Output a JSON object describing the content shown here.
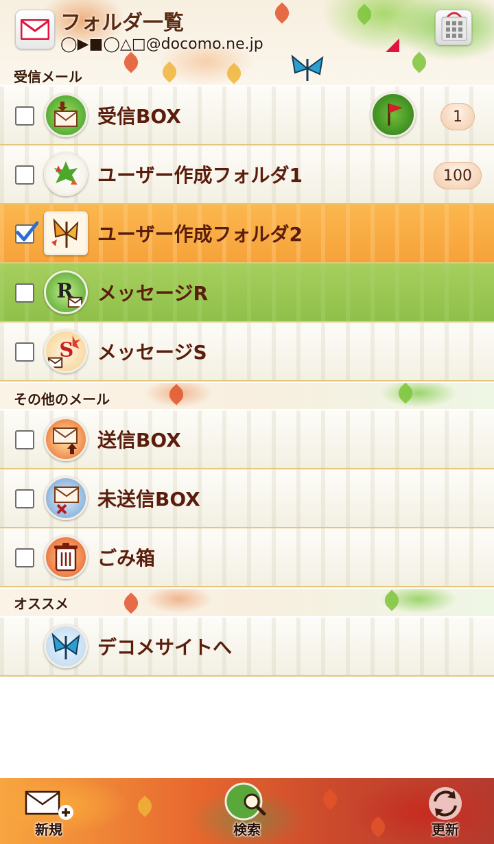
{
  "header": {
    "title": "フォルダ一覧",
    "address": "◯▶■◯△□@docomo.ne.jp"
  },
  "sections": {
    "inbox": "受信メール",
    "other": "その他のメール",
    "recommend": "オススメ"
  },
  "inbox_folders": [
    {
      "name": "受信BOX",
      "count": "1",
      "checked": false
    },
    {
      "name": "ユーザー作成フォルダ1",
      "count": "100",
      "checked": false
    },
    {
      "name": "ユーザー作成フォルダ2",
      "count": "",
      "checked": true
    },
    {
      "name": "メッセージR",
      "count": "",
      "checked": false
    },
    {
      "name": "メッセージS",
      "count": "",
      "checked": false
    }
  ],
  "other_folders": [
    {
      "name": "送信BOX"
    },
    {
      "name": "未送信BOX"
    },
    {
      "name": "ごみ箱"
    }
  ],
  "recommend_items": [
    {
      "name": "デコメサイトへ"
    }
  ],
  "toolbar": {
    "new_label": "新規",
    "search_label": "検索",
    "refresh_label": "更新"
  },
  "colors": {
    "title_text": "#5b2a0f",
    "folder_text": "#5a1d0c",
    "selected_row": "#f6a23a",
    "focused_row": "#8fc04a",
    "signal": "#e0143c"
  }
}
